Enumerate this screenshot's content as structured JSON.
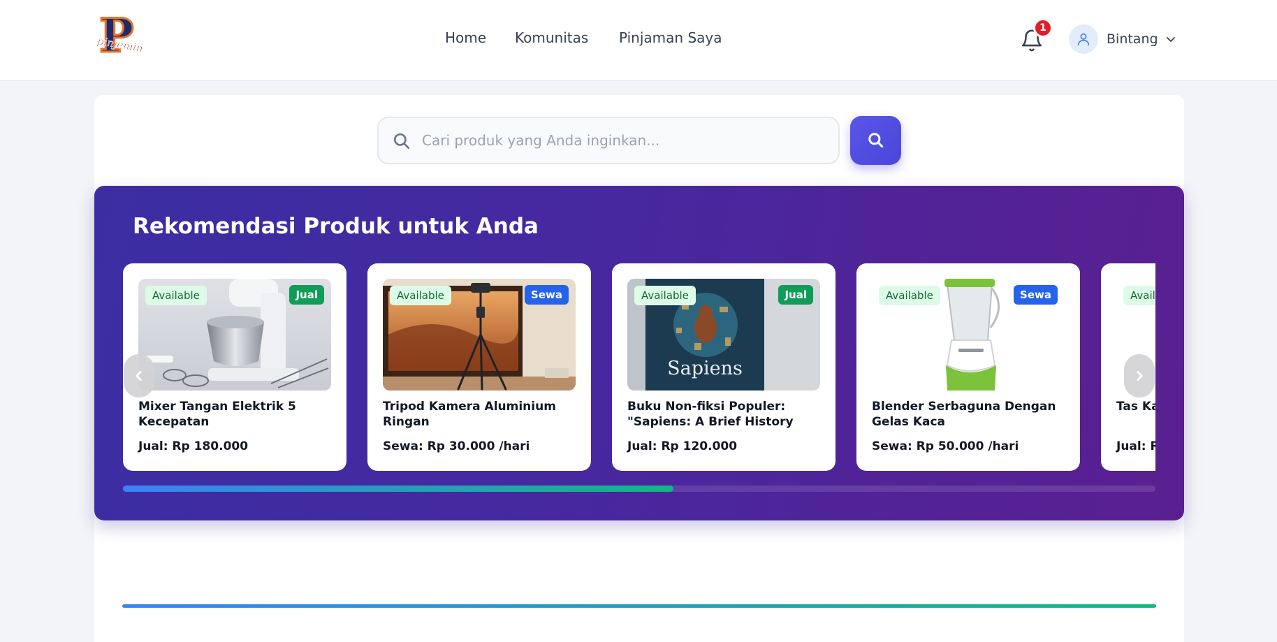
{
  "header": {
    "logo_text": "pinjemin",
    "nav": [
      "Home",
      "Komunitas",
      "Pinjaman Saya"
    ],
    "notification_count": "1",
    "user_name": "Bintang"
  },
  "search": {
    "placeholder": "Cari produk yang Anda inginkan..."
  },
  "recommendations": {
    "title": "Rekomendasi Produk untuk Anda",
    "progress_fraction": 0.533,
    "items": [
      {
        "name": "Mixer Tangan Elektrik 5 Kecepatan",
        "status": "Available",
        "type": "Jual",
        "price": "Jual: Rp 180.000"
      },
      {
        "name": "Tripod Kamera Aluminium Ringan",
        "status": "Available",
        "type": "Sewa",
        "price": "Sewa: Rp 30.000 /hari"
      },
      {
        "name": "Buku Non-fiksi Populer: \"Sapiens: A Brief History of…",
        "status": "Available",
        "type": "Jual",
        "price": "Jual: Rp 120.000",
        "cover_title": "Sapiens"
      },
      {
        "name": "Blender Serbaguna Dengan Gelas Kaca",
        "status": "Available",
        "type": "Sewa",
        "price": "Sewa: Rp 50.000 /hari"
      },
      {
        "name": "Tas Ka ProTac",
        "status": "Avail",
        "type": "",
        "price": "Jual: R"
      }
    ]
  },
  "colors": {
    "accent": "#4f46e5",
    "jual": "#0f9d58",
    "sewa": "#2563eb",
    "available_bg": "#dcfce7",
    "banner_start": "#3b2ea3",
    "banner_end": "#5a1f90"
  }
}
